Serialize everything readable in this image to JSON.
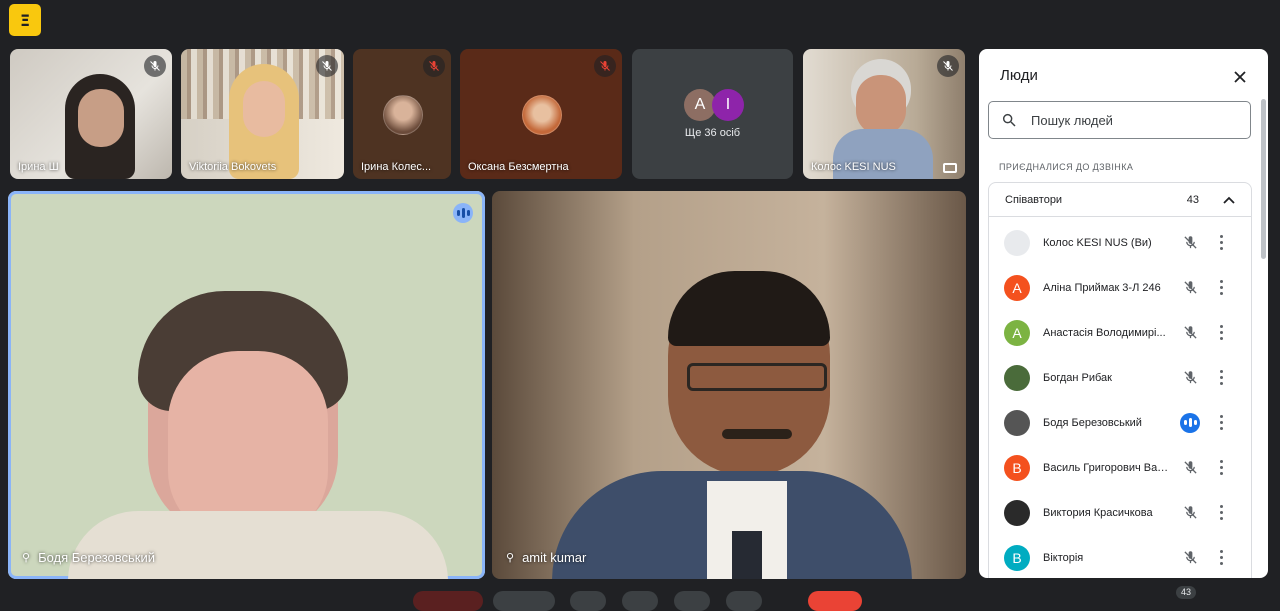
{
  "app_logo": "Ξ",
  "top_tiles": [
    {
      "name": "Ірина Ш"
    },
    {
      "name": "Viktoriia Bokovets"
    },
    {
      "name": "Ірина Колес..."
    },
    {
      "name": "Оксана Безсмертна"
    },
    {
      "more_label": "Ще 36 осіб",
      "avatars": [
        "A",
        "I"
      ]
    },
    {
      "name": "Колос KESI NUS"
    }
  ],
  "main_tiles": [
    {
      "name": "Бодя Березовський"
    },
    {
      "name": "amit kumar"
    }
  ],
  "people_panel": {
    "title": "Люди",
    "search_placeholder": "Пошук людей",
    "section_label": "ПРИЄДНАЛИСЯ ДО ДЗВІНКА",
    "group_label": "Співавтори",
    "group_count": "43",
    "participants": [
      {
        "initial": "",
        "name": "Колос KESI NUS (Ви)",
        "color": "#e8eaed",
        "speaking": false
      },
      {
        "initial": "A",
        "name": "Аліна Приймак 3-Л 246",
        "color": "#f4511e",
        "speaking": false
      },
      {
        "initial": "A",
        "name": "Анастасія Володимирі...",
        "color": "#7cb342",
        "speaking": false
      },
      {
        "initial": "",
        "name": "Богдан Рибак",
        "color": "#4a6b3a",
        "speaking": false
      },
      {
        "initial": "",
        "name": "Бодя Березовський",
        "color": "#555555",
        "speaking": true
      },
      {
        "initial": "B",
        "name": "Василь Григорович Ваз...",
        "color": "#f4511e",
        "speaking": false
      },
      {
        "initial": "",
        "name": "Виктория Красичкова",
        "color": "#2a2a2a",
        "speaking": false
      },
      {
        "initial": "B",
        "name": "Вікторія",
        "color": "#00acc1",
        "speaking": false
      }
    ]
  },
  "participant_count_badge": "43",
  "colors": {
    "accent": "#1a73e8",
    "speaking_border": "#8ab4f8",
    "background": "#202124"
  }
}
